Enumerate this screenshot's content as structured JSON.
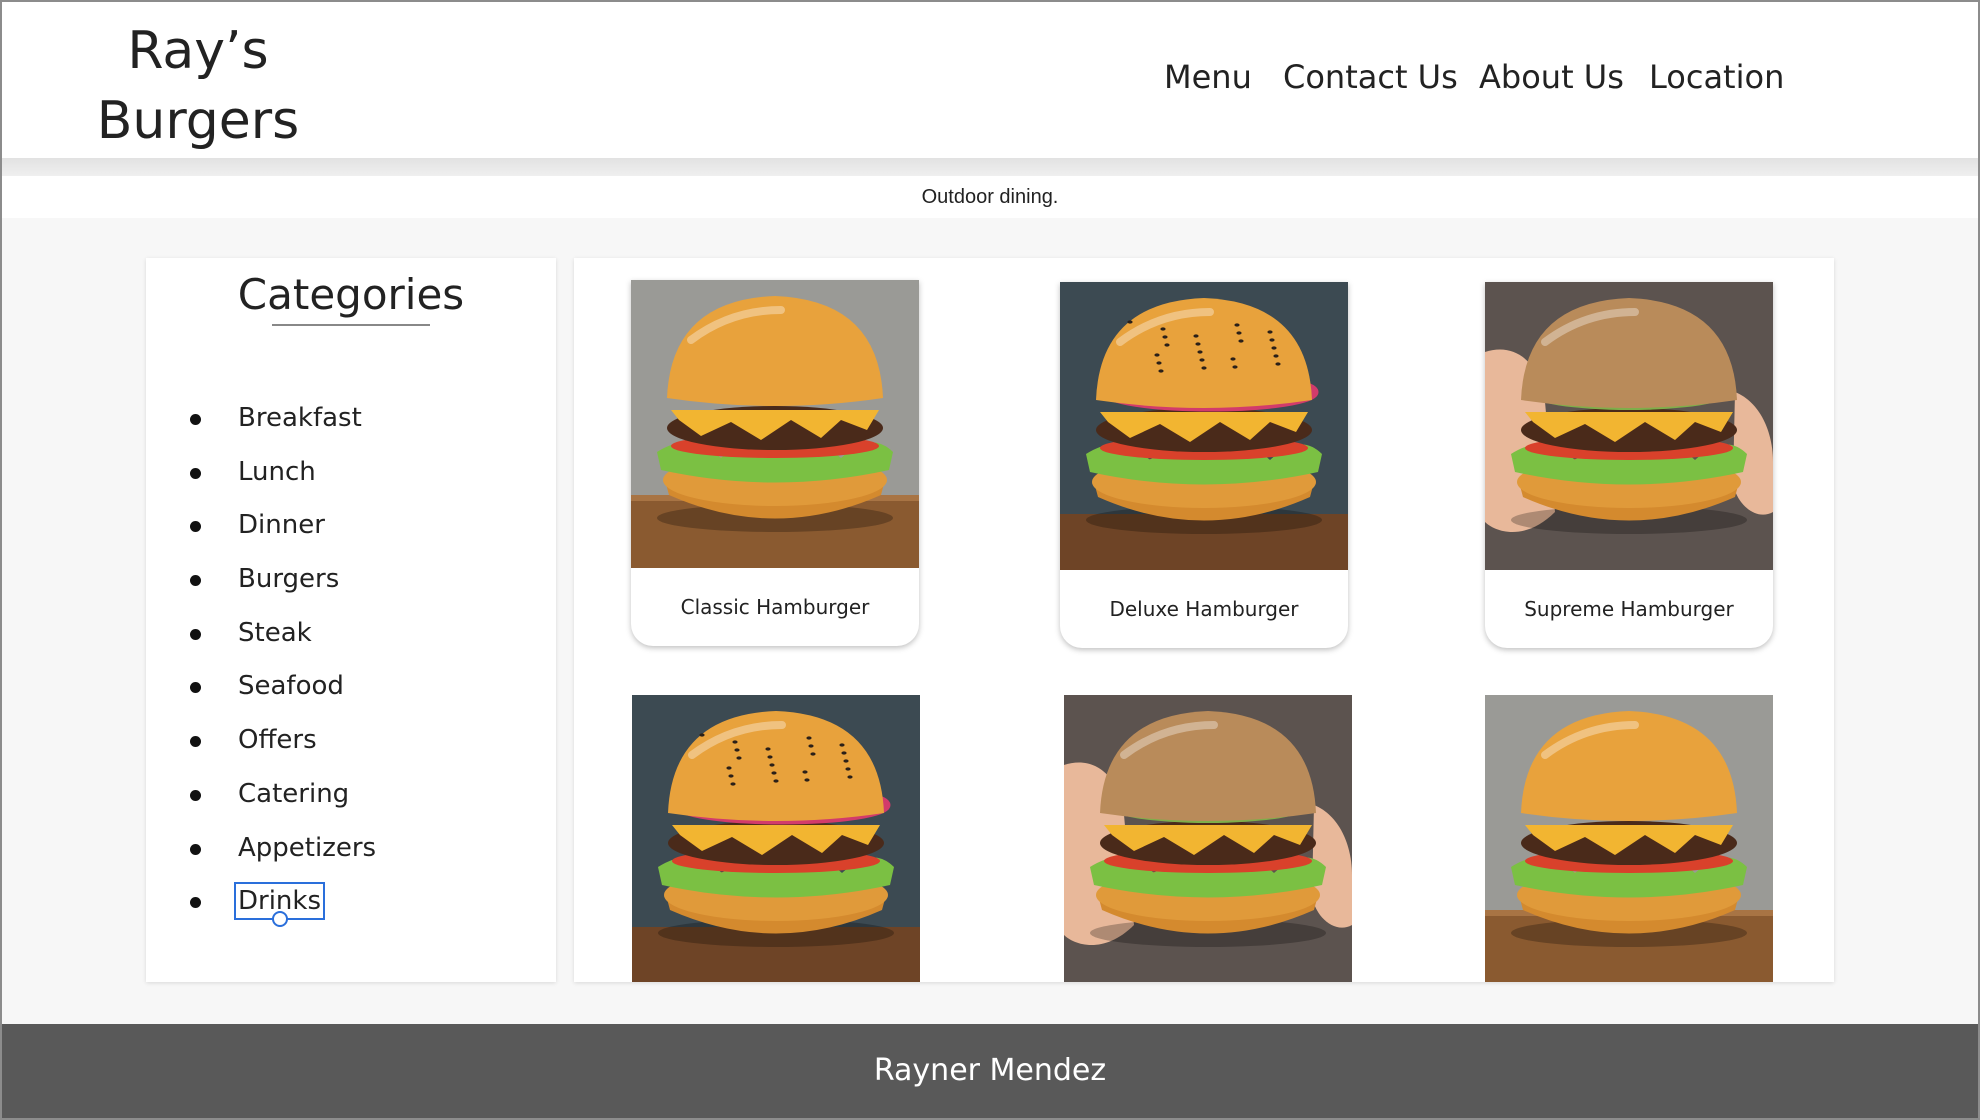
{
  "header": {
    "logo_line1": "Ray’s",
    "logo_line2": "Burgers",
    "nav": [
      {
        "label": "Menu"
      },
      {
        "label": "Contact Us"
      },
      {
        "label": "About Us"
      },
      {
        "label": "Location"
      }
    ]
  },
  "tagline": "Outdoor dining.",
  "sidebar": {
    "title": "Categories",
    "items": [
      {
        "label": "Breakfast"
      },
      {
        "label": "Lunch"
      },
      {
        "label": "Dinner"
      },
      {
        "label": "Burgers"
      },
      {
        "label": "Steak"
      },
      {
        "label": "Seafood"
      },
      {
        "label": "Offers"
      },
      {
        "label": "Catering"
      },
      {
        "label": "Appetizers"
      },
      {
        "label": "Drinks",
        "selected": true
      }
    ]
  },
  "gallery": {
    "cards": [
      {
        "label": "Classic Hamburger",
        "photo": "classic"
      },
      {
        "label": "Deluxe Hamburger",
        "photo": "deluxe"
      },
      {
        "label": "Supreme Hamburger",
        "photo": "supreme"
      },
      {
        "label": "",
        "photo": "deluxe"
      },
      {
        "label": "",
        "photo": "supreme"
      },
      {
        "label": "",
        "photo": "classic"
      }
    ]
  },
  "footer": {
    "text": "Rayner Mendez"
  },
  "colors": {
    "footer_bg": "#595959",
    "selection_outline": "#2a6fdb",
    "bun": "#e8a23c",
    "cheese": "#f2b531",
    "lettuce": "#7bc043",
    "patty": "#4a2a1a"
  },
  "icons": [
    "list-bullet-icon",
    "burger-photo"
  ]
}
